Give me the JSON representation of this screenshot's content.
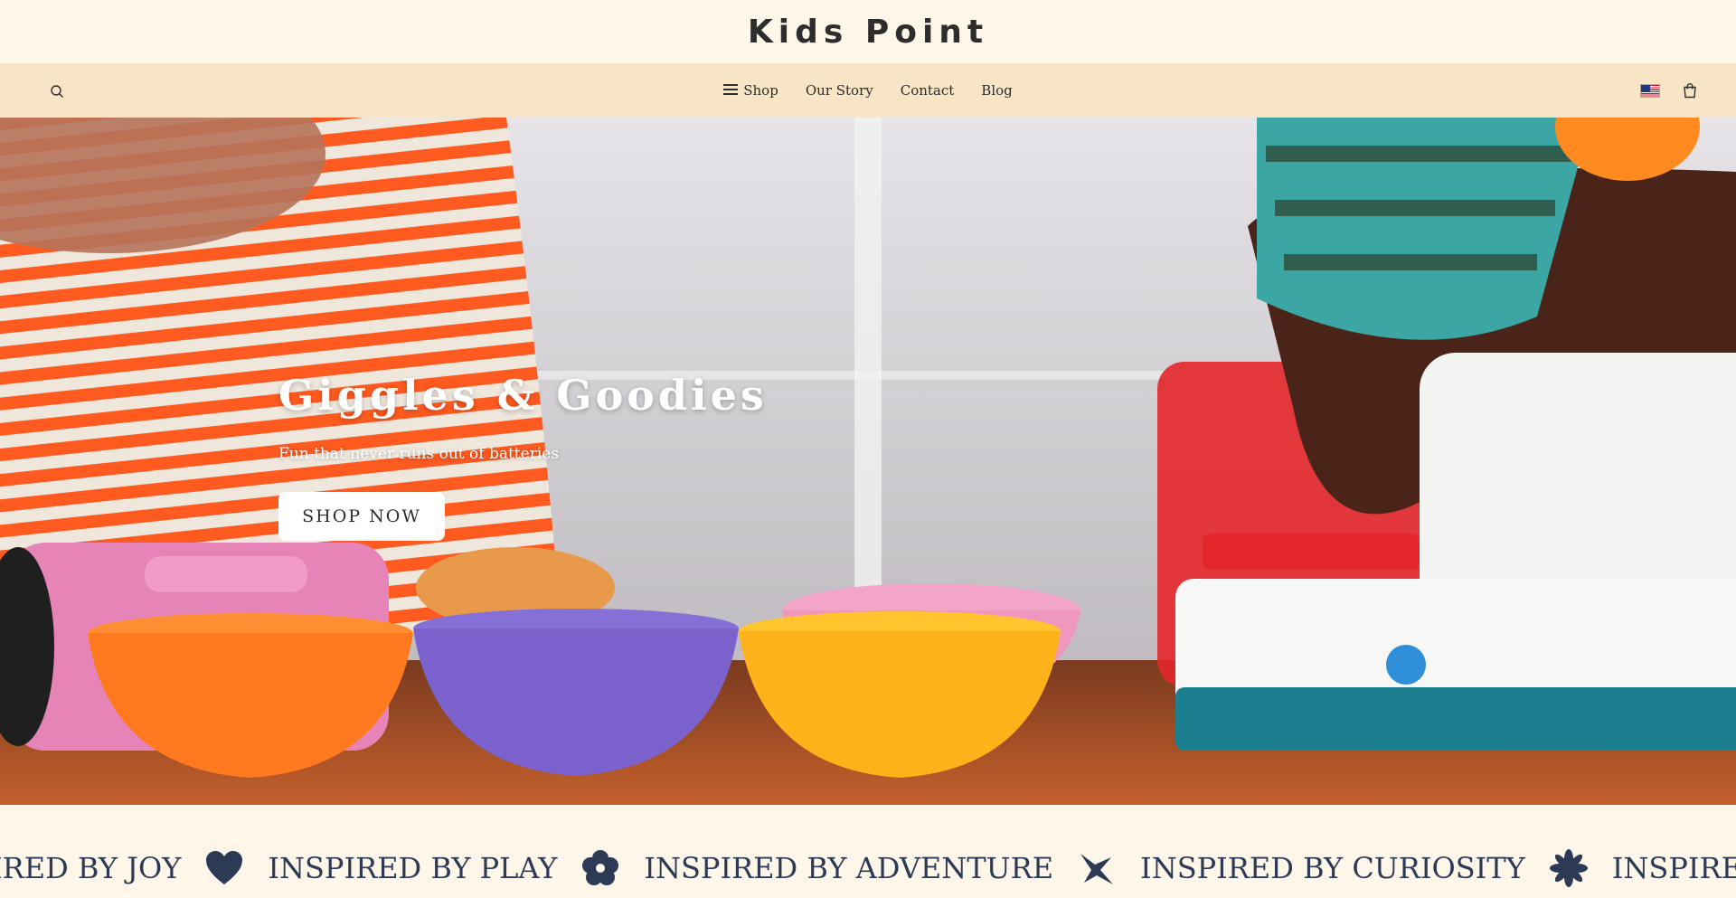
{
  "brand": {
    "logo": "Kids Point"
  },
  "nav": {
    "search_icon": "search-icon",
    "links": [
      {
        "label": "Shop",
        "icon": "hamburger-menu-icon"
      },
      {
        "label": "Our Story"
      },
      {
        "label": "Contact"
      },
      {
        "label": "Blog"
      }
    ],
    "right_icons": [
      "us-flag-icon",
      "shopping-bag-icon"
    ]
  },
  "hero": {
    "title": "Giggles & Goodies",
    "subtitle": "Fun that never runs out of batteries",
    "button_label": "SHOP NOW"
  },
  "marquee": {
    "items": [
      {
        "text": "IRED BY JOY",
        "icon": "heart-icon"
      },
      {
        "text": "INSPIRED BY PLAY",
        "icon": "flower-icon"
      },
      {
        "text": "INSPIRED BY ADVENTURE",
        "icon": "airplane-icon"
      },
      {
        "text": "INSPIRED BY CURIOSITY",
        "icon": "asterisk-icon"
      },
      {
        "text": "INSPIRED BY"
      }
    ]
  },
  "colors": {
    "page_bg": "#fdf6e9",
    "nav_bg": "#f8e5c6",
    "text_dark": "#2d2d2d",
    "marquee_text": "#2d3a55",
    "button_bg": "#ffffff"
  }
}
